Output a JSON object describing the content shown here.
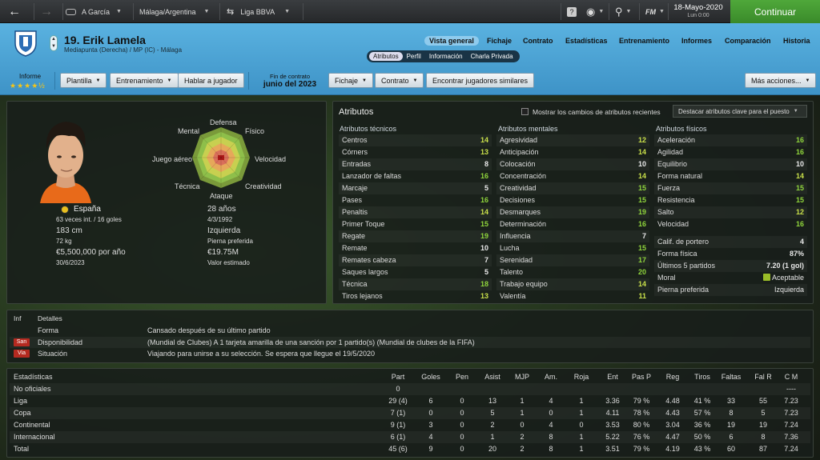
{
  "topbar": {
    "club": "A García",
    "location": "Málaga/Argentina",
    "league": "Liga BBVA",
    "fm": "FM",
    "date": "18-Mayo-2020",
    "time": "Lun 0:00",
    "continue": "Continuar"
  },
  "player": {
    "title": "19. Erik Lamela",
    "position": "Mediapunta (Derecha) / MP (IC) - Málaga",
    "report_label": "Informe",
    "stars": "★★★★½"
  },
  "nav": [
    "Vista general",
    "Fichaje",
    "Contrato",
    "Estadísticas",
    "Entrenamiento",
    "Informes",
    "Comparación",
    "Historia"
  ],
  "subtabs": [
    "Atributos",
    "Perfil",
    "Información",
    "Charla Privada"
  ],
  "buttons": {
    "squad": "Plantilla",
    "training": "Entrenamiento",
    "talk": "Hablar a jugador",
    "transfer": "Fichaje",
    "contract": "Contrato",
    "similar": "Encontrar jugadores similares",
    "more": "Más acciones..."
  },
  "contract": {
    "label": "Fin de contrato",
    "value": "junio del 2023"
  },
  "bio": {
    "nation": "España",
    "caps": "63 veces int. / 16 goles",
    "age": "28 años",
    "dob": "4/3/1992",
    "height": "183 cm",
    "foot": "Izquierda",
    "foot_label": "Pierna preferida",
    "weight": "72 kg",
    "value": "€19.75M",
    "value_label": "Valor estimado",
    "wage": "€5,500,000 por año",
    "expires": "30/6/2023"
  },
  "radar": {
    "defense": "Defensa",
    "physical": "Físico",
    "speed": "Velocidad",
    "creativity": "Creatividad",
    "attack": "Ataque",
    "technique": "Técnica",
    "aerial": "Juego aéreo",
    "mental": "Mental"
  },
  "attributes": {
    "title": "Atributos",
    "show_changes": "Mostrar los cambios de atributos recientes",
    "highlight": "Destacar atributos clave para el puesto",
    "technical_title": "Atributos técnicos",
    "mental_title": "Atributos mentales",
    "physical_title": "Atributos físicos",
    "technical": [
      [
        "Centros",
        "14"
      ],
      [
        "Córners",
        "13"
      ],
      [
        "Entradas",
        "8"
      ],
      [
        "Lanzador de faltas",
        "16"
      ],
      [
        "Marcaje",
        "5"
      ],
      [
        "Pases",
        "16"
      ],
      [
        "Penaltis",
        "14"
      ],
      [
        "Primer Toque",
        "15"
      ],
      [
        "Regate",
        "19"
      ],
      [
        "Remate",
        "10"
      ],
      [
        "Remates cabeza",
        "7"
      ],
      [
        "Saques largos",
        "5"
      ],
      [
        "Técnica",
        "18"
      ],
      [
        "Tiros lejanos",
        "13"
      ]
    ],
    "mental": [
      [
        "Agresividad",
        "12"
      ],
      [
        "Anticipación",
        "14"
      ],
      [
        "Colocación",
        "10"
      ],
      [
        "Concentración",
        "14"
      ],
      [
        "Creatividad",
        "15"
      ],
      [
        "Decisiones",
        "15"
      ],
      [
        "Desmarques",
        "19"
      ],
      [
        "Determinación",
        "16"
      ],
      [
        "Influencia",
        "7"
      ],
      [
        "Lucha",
        "15"
      ],
      [
        "Serenidad",
        "17"
      ],
      [
        "Talento",
        "20"
      ],
      [
        "Trabajo equipo",
        "14"
      ],
      [
        "Valentía",
        "11"
      ]
    ],
    "physical": [
      [
        "Aceleración",
        "16"
      ],
      [
        "Agilidad",
        "16"
      ],
      [
        "Equilibrio",
        "10"
      ],
      [
        "Forma natural",
        "14"
      ],
      [
        "Fuerza",
        "15"
      ],
      [
        "Resistencia",
        "15"
      ],
      [
        "Salto",
        "12"
      ],
      [
        "Velocidad",
        "16"
      ]
    ],
    "extra": [
      [
        "Calif. de portero",
        "4"
      ],
      [
        "Forma física",
        "87%"
      ],
      [
        "Últimos 5 partidos",
        "7.20 (1 gol)"
      ],
      [
        "Moral",
        "Aceptable"
      ],
      [
        "Pierna preferida",
        "Izquierda"
      ]
    ]
  },
  "details": {
    "inf": "Inf",
    "title": "Detalles",
    "rows": [
      {
        "badge": "",
        "label": "Forma",
        "text": "Cansado después de su último partido"
      },
      {
        "badge": "San",
        "label": "Disponibilidad",
        "text": "(Mundial de Clubes) A 1 tarjeta amarilla de una sanción por 1 partido(s) (Mundial de clubes de la FIFA)"
      },
      {
        "badge": "Via",
        "label": "Situación",
        "text": "Viajando para unirse a su selección. Se espera que llegue el 19/5/2020"
      }
    ]
  },
  "stats": {
    "title": "Estadísticas",
    "headers": [
      "Part",
      "Goles",
      "Pen",
      "Asist",
      "MJP",
      "Am.",
      "Roja",
      "Ent",
      "Pas P",
      "Reg",
      "Tiros",
      "Faltas",
      "Fal R",
      "C M"
    ],
    "rows": [
      {
        "name": "No oficiales",
        "vals": [
          "0",
          "",
          "",
          "",
          "",
          "",
          "",
          "",
          "",
          "",
          "",
          "",
          "",
          "----"
        ]
      },
      {
        "name": "Liga",
        "vals": [
          "29 (4)",
          "6",
          "0",
          "13",
          "1",
          "4",
          "1",
          "3.36",
          "79 %",
          "4.48",
          "41 %",
          "33",
          "55",
          "7.23"
        ]
      },
      {
        "name": "Copa",
        "vals": [
          "7 (1)",
          "0",
          "0",
          "5",
          "1",
          "0",
          "1",
          "4.11",
          "78 %",
          "4.43",
          "57 %",
          "8",
          "5",
          "7.23"
        ]
      },
      {
        "name": "Continental",
        "vals": [
          "9 (1)",
          "3",
          "0",
          "2",
          "0",
          "4",
          "0",
          "3.53",
          "80 %",
          "3.04",
          "36 %",
          "19",
          "19",
          "7.24"
        ]
      },
      {
        "name": "Internacional",
        "vals": [
          "6 (1)",
          "4",
          "0",
          "1",
          "2",
          "8",
          "1",
          "5.22",
          "76 %",
          "4.47",
          "50 %",
          "6",
          "8",
          "7.36"
        ]
      },
      {
        "name": "Total",
        "vals": [
          "45 (6)",
          "9",
          "0",
          "20",
          "2",
          "8",
          "1",
          "3.51",
          "79 %",
          "4.19",
          "43 %",
          "60",
          "87",
          "7.24"
        ]
      }
    ]
  }
}
